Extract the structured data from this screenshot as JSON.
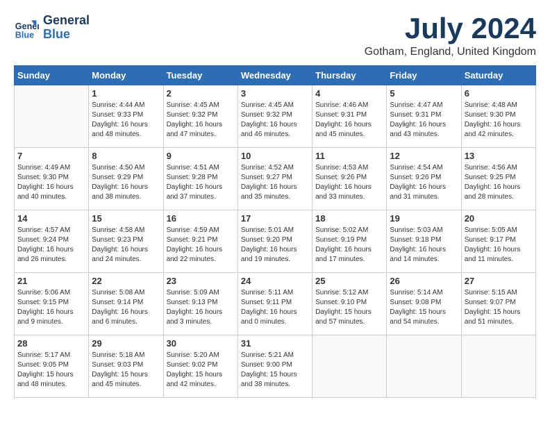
{
  "header": {
    "logo_line1": "General",
    "logo_line2": "Blue",
    "month": "July 2024",
    "location": "Gotham, England, United Kingdom"
  },
  "weekdays": [
    "Sunday",
    "Monday",
    "Tuesday",
    "Wednesday",
    "Thursday",
    "Friday",
    "Saturday"
  ],
  "weeks": [
    [
      {
        "day": "",
        "info": ""
      },
      {
        "day": "1",
        "info": "Sunrise: 4:44 AM\nSunset: 9:33 PM\nDaylight: 16 hours\nand 48 minutes."
      },
      {
        "day": "2",
        "info": "Sunrise: 4:45 AM\nSunset: 9:32 PM\nDaylight: 16 hours\nand 47 minutes."
      },
      {
        "day": "3",
        "info": "Sunrise: 4:45 AM\nSunset: 9:32 PM\nDaylight: 16 hours\nand 46 minutes."
      },
      {
        "day": "4",
        "info": "Sunrise: 4:46 AM\nSunset: 9:31 PM\nDaylight: 16 hours\nand 45 minutes."
      },
      {
        "day": "5",
        "info": "Sunrise: 4:47 AM\nSunset: 9:31 PM\nDaylight: 16 hours\nand 43 minutes."
      },
      {
        "day": "6",
        "info": "Sunrise: 4:48 AM\nSunset: 9:30 PM\nDaylight: 16 hours\nand 42 minutes."
      }
    ],
    [
      {
        "day": "7",
        "info": "Sunrise: 4:49 AM\nSunset: 9:30 PM\nDaylight: 16 hours\nand 40 minutes."
      },
      {
        "day": "8",
        "info": "Sunrise: 4:50 AM\nSunset: 9:29 PM\nDaylight: 16 hours\nand 38 minutes."
      },
      {
        "day": "9",
        "info": "Sunrise: 4:51 AM\nSunset: 9:28 PM\nDaylight: 16 hours\nand 37 minutes."
      },
      {
        "day": "10",
        "info": "Sunrise: 4:52 AM\nSunset: 9:27 PM\nDaylight: 16 hours\nand 35 minutes."
      },
      {
        "day": "11",
        "info": "Sunrise: 4:53 AM\nSunset: 9:26 PM\nDaylight: 16 hours\nand 33 minutes."
      },
      {
        "day": "12",
        "info": "Sunrise: 4:54 AM\nSunset: 9:26 PM\nDaylight: 16 hours\nand 31 minutes."
      },
      {
        "day": "13",
        "info": "Sunrise: 4:56 AM\nSunset: 9:25 PM\nDaylight: 16 hours\nand 28 minutes."
      }
    ],
    [
      {
        "day": "14",
        "info": "Sunrise: 4:57 AM\nSunset: 9:24 PM\nDaylight: 16 hours\nand 26 minutes."
      },
      {
        "day": "15",
        "info": "Sunrise: 4:58 AM\nSunset: 9:23 PM\nDaylight: 16 hours\nand 24 minutes."
      },
      {
        "day": "16",
        "info": "Sunrise: 4:59 AM\nSunset: 9:21 PM\nDaylight: 16 hours\nand 22 minutes."
      },
      {
        "day": "17",
        "info": "Sunrise: 5:01 AM\nSunset: 9:20 PM\nDaylight: 16 hours\nand 19 minutes."
      },
      {
        "day": "18",
        "info": "Sunrise: 5:02 AM\nSunset: 9:19 PM\nDaylight: 16 hours\nand 17 minutes."
      },
      {
        "day": "19",
        "info": "Sunrise: 5:03 AM\nSunset: 9:18 PM\nDaylight: 16 hours\nand 14 minutes."
      },
      {
        "day": "20",
        "info": "Sunrise: 5:05 AM\nSunset: 9:17 PM\nDaylight: 16 hours\nand 11 minutes."
      }
    ],
    [
      {
        "day": "21",
        "info": "Sunrise: 5:06 AM\nSunset: 9:15 PM\nDaylight: 16 hours\nand 9 minutes."
      },
      {
        "day": "22",
        "info": "Sunrise: 5:08 AM\nSunset: 9:14 PM\nDaylight: 16 hours\nand 6 minutes."
      },
      {
        "day": "23",
        "info": "Sunrise: 5:09 AM\nSunset: 9:13 PM\nDaylight: 16 hours\nand 3 minutes."
      },
      {
        "day": "24",
        "info": "Sunrise: 5:11 AM\nSunset: 9:11 PM\nDaylight: 16 hours\nand 0 minutes."
      },
      {
        "day": "25",
        "info": "Sunrise: 5:12 AM\nSunset: 9:10 PM\nDaylight: 15 hours\nand 57 minutes."
      },
      {
        "day": "26",
        "info": "Sunrise: 5:14 AM\nSunset: 9:08 PM\nDaylight: 15 hours\nand 54 minutes."
      },
      {
        "day": "27",
        "info": "Sunrise: 5:15 AM\nSunset: 9:07 PM\nDaylight: 15 hours\nand 51 minutes."
      }
    ],
    [
      {
        "day": "28",
        "info": "Sunrise: 5:17 AM\nSunset: 9:05 PM\nDaylight: 15 hours\nand 48 minutes."
      },
      {
        "day": "29",
        "info": "Sunrise: 5:18 AM\nSunset: 9:03 PM\nDaylight: 15 hours\nand 45 minutes."
      },
      {
        "day": "30",
        "info": "Sunrise: 5:20 AM\nSunset: 9:02 PM\nDaylight: 15 hours\nand 42 minutes."
      },
      {
        "day": "31",
        "info": "Sunrise: 5:21 AM\nSunset: 9:00 PM\nDaylight: 15 hours\nand 38 minutes."
      },
      {
        "day": "",
        "info": ""
      },
      {
        "day": "",
        "info": ""
      },
      {
        "day": "",
        "info": ""
      }
    ]
  ]
}
